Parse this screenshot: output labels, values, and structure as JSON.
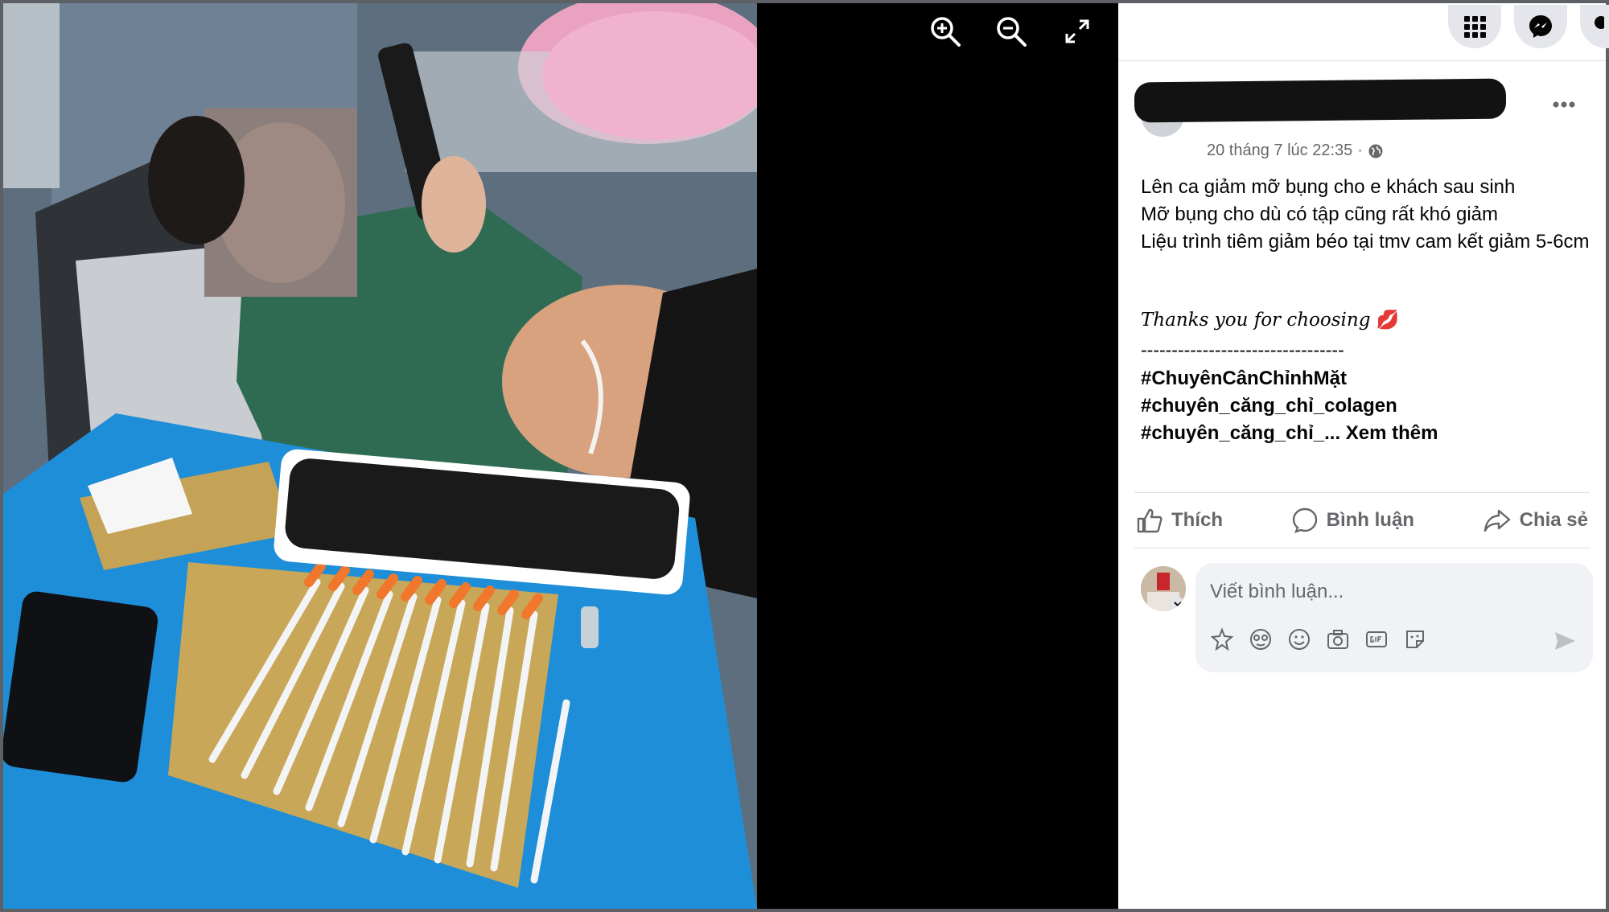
{
  "viewer": {
    "zoom_in_icon": "zoom-in-icon",
    "zoom_out_icon": "zoom-out-icon",
    "fullscreen_icon": "fullscreen-icon"
  },
  "topbar": {
    "menu_icon": "grid-menu-icon",
    "messenger_icon": "messenger-icon"
  },
  "post": {
    "timestamp": "20 tháng 7 lúc 22:35",
    "separator": "·",
    "audience_icon": "globe-icon",
    "lines": [
      "Lên ca giảm mỡ bụng cho e khách sau sinh",
      "Mỡ bụng cho dù có tập cũng rất khó giảm",
      "Liệu trình tiêm giảm béo tại tmv cam kết giảm 5-6cm"
    ],
    "thanks": "Thanks you for choosing",
    "thanks_emoji": "💋",
    "dashes": "---------------------------------",
    "hashtags": [
      "#ChuyênCânChỉnhMặt",
      "#chuyên_căng_chỉ_colagen",
      "#chuyên_căng_chỉ_..."
    ],
    "see_more": "Xem thêm"
  },
  "actions": {
    "like": "Thích",
    "comment": "Bình luận",
    "share": "Chia sẻ"
  },
  "comment": {
    "placeholder": "Viết bình luận..."
  }
}
